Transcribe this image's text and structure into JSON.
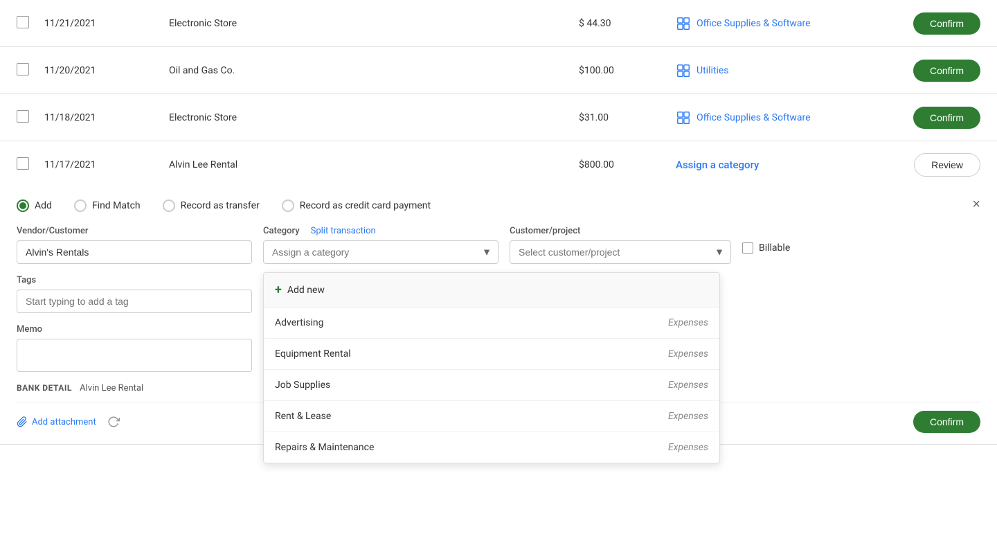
{
  "rows": [
    {
      "date": "11/21/2021",
      "vendor": "Electronic Store",
      "amount": "$ 44.30",
      "category": "Office Supplies & Software",
      "hasCategory": true,
      "action": "Confirm"
    },
    {
      "date": "11/20/2021",
      "vendor": "Oil and Gas Co.",
      "amount": "$100.00",
      "category": "Utilities",
      "hasCategory": true,
      "action": "Confirm"
    },
    {
      "date": "11/18/2021",
      "vendor": "Electronic Store",
      "amount": "$31.00",
      "category": "Office Supplies & Software",
      "hasCategory": true,
      "action": "Confirm"
    },
    {
      "date": "11/17/2021",
      "vendor": "Alvin Lee Rental",
      "amount": "$800.00",
      "category": null,
      "hasCategory": false,
      "action": "Review"
    }
  ],
  "expandedPanel": {
    "radioOptions": [
      {
        "id": "add",
        "label": "Add",
        "checked": true
      },
      {
        "id": "findmatch",
        "label": "Find Match",
        "checked": false
      },
      {
        "id": "recordtransfer",
        "label": "Record as transfer",
        "checked": false
      },
      {
        "id": "creditcard",
        "label": "Record as credit card payment",
        "checked": false
      }
    ],
    "vendorLabel": "Vendor/Customer",
    "vendorValue": "Alvin's Rentals",
    "categoryLabel": "Category",
    "categoryPlaceholder": "Assign a category",
    "splitLink": "Split transaction",
    "customerLabel": "Customer/project",
    "customerPlaceholder": "Select customer/project",
    "billableLabel": "Billable",
    "tagsLabel": "Tags",
    "tagsPlaceholder": "Start typing to add a tag",
    "memoLabel": "Memo",
    "bankDetailLabel": "BANK DETAIL",
    "bankDetailValue": "Alvin Lee Rental",
    "addAttachmentLabel": "Add attachment",
    "confirmLabel": "Confirm",
    "closeLabel": "×",
    "assignCategoryLabel": "Assign a category"
  },
  "categoryDropdown": {
    "items": [
      {
        "name": "Add new",
        "type": "",
        "isAddNew": true
      },
      {
        "name": "Advertising",
        "type": "Expenses"
      },
      {
        "name": "Equipment Rental",
        "type": "Expenses"
      },
      {
        "name": "Job Supplies",
        "type": "Expenses"
      },
      {
        "name": "Rent & Lease",
        "type": "Expenses"
      },
      {
        "name": "Repairs & Maintenance",
        "type": "Expenses"
      }
    ]
  },
  "colors": {
    "confirmGreen": "#2e7d32",
    "linkBlue": "#2a7af3",
    "reviewBorder": "#ccc"
  }
}
